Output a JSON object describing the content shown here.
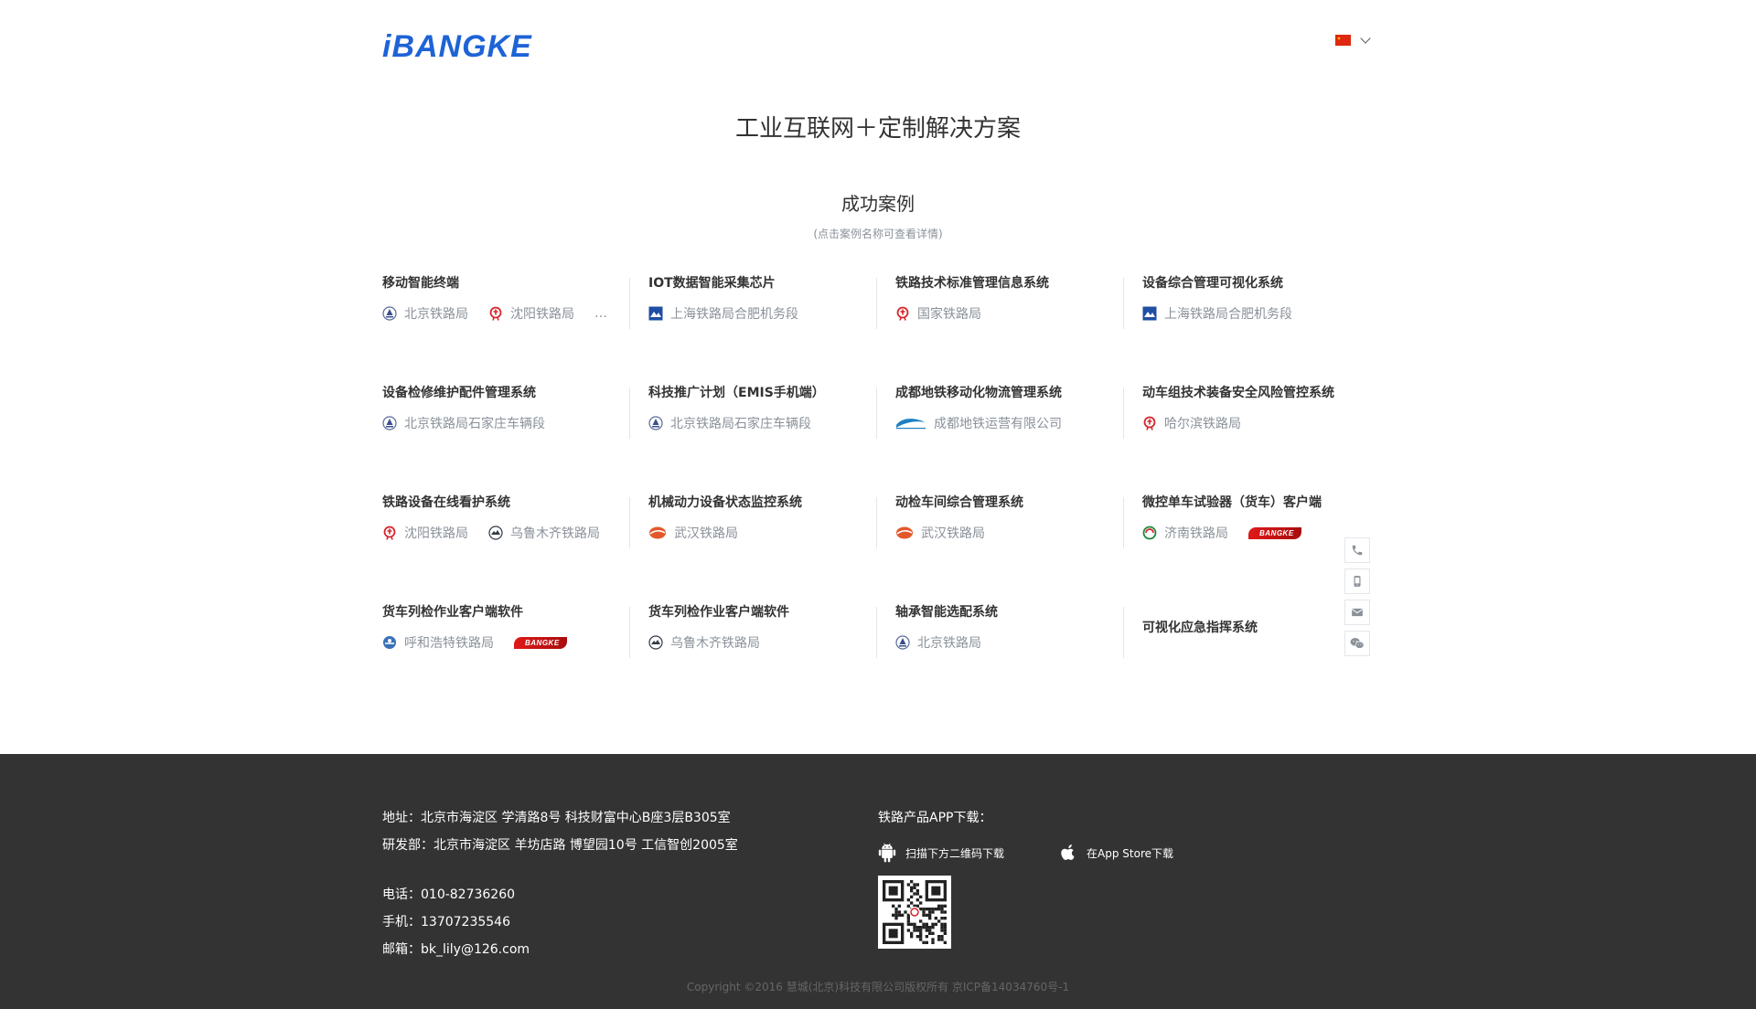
{
  "header": {
    "logo_text": "iBANGKE",
    "language_flag": "china-flag-icon"
  },
  "titles": {
    "main": "工业互联网＋定制解决方案",
    "section": "成功案例",
    "hint": "(点击案例名称可查看详情)"
  },
  "cases": [
    {
      "title": "移动智能终端",
      "clients": [
        {
          "name": "北京铁路局",
          "icon": "beijing-rail-icon"
        },
        {
          "name": "沈阳铁路局",
          "icon": "rail-logo-icon"
        }
      ],
      "more": "…"
    },
    {
      "title": "IOT数据智能采集芯片",
      "clients": [
        {
          "name": "上海铁路局合肥机务段",
          "icon": "shanghai-rail-icon"
        }
      ]
    },
    {
      "title": "铁路技术标准管理信息系统",
      "clients": [
        {
          "name": "国家铁路局",
          "icon": "rail-logo-icon"
        }
      ]
    },
    {
      "title": "设备综合管理可视化系统",
      "clients": [
        {
          "name": "上海铁路局合肥机务段",
          "icon": "shanghai-rail-icon"
        }
      ]
    },
    {
      "title": "设备检修维护配件管理系统",
      "clients": [
        {
          "name": "北京铁路局石家庄车辆段",
          "icon": "beijing-rail-icon"
        }
      ]
    },
    {
      "title": "科技推广计划（EMIS手机端）",
      "clients": [
        {
          "name": "北京铁路局石家庄车辆段",
          "icon": "beijing-rail-icon"
        }
      ]
    },
    {
      "title": "成都地铁移动化物流管理系统",
      "clients": [
        {
          "name": "成都地铁运营有限公司",
          "icon": "chengdu-metro-icon"
        }
      ]
    },
    {
      "title": "动车组技术装备安全风险管控系统",
      "clients": [
        {
          "name": "哈尔滨铁路局",
          "icon": "rail-logo-icon"
        }
      ]
    },
    {
      "title": "铁路设备在线看护系统",
      "clients": [
        {
          "name": "沈阳铁路局",
          "icon": "rail-logo-icon"
        },
        {
          "name": "乌鲁木齐铁路局",
          "icon": "urumqi-rail-icon"
        }
      ]
    },
    {
      "title": "机械动力设备状态监控系统",
      "clients": [
        {
          "name": "武汉铁路局",
          "icon": "wuhan-rail-icon"
        }
      ]
    },
    {
      "title": "动检车间综合管理系统",
      "clients": [
        {
          "name": "武汉铁路局",
          "icon": "wuhan-rail-icon"
        }
      ]
    },
    {
      "title": "微控单车试验器（货车）客户端",
      "clients": [
        {
          "name": "济南铁路局",
          "icon": "jinan-rail-icon"
        },
        {
          "name": "",
          "icon": "bangke-logo-icon",
          "logo_text": "BANGKE"
        }
      ]
    },
    {
      "title": "货车列检作业客户端软件",
      "clients": [
        {
          "name": "呼和浩特铁路局",
          "icon": "hohhot-rail-icon"
        },
        {
          "name": "",
          "icon": "bangke-logo-icon",
          "logo_text": "BANGKE"
        }
      ]
    },
    {
      "title": "货车列检作业客户端软件",
      "clients": [
        {
          "name": "乌鲁木齐铁路局",
          "icon": "urumqi-rail-icon"
        }
      ]
    },
    {
      "title": "轴承智能选配系统",
      "clients": [
        {
          "name": "北京铁路局",
          "icon": "beijing-rail-icon"
        }
      ]
    },
    {
      "title": "可视化应急指挥系统",
      "clients": []
    }
  ],
  "sidebar": [
    "phone-icon",
    "mobile-icon",
    "mail-icon",
    "wechat-icon"
  ],
  "footer": {
    "address": "地址：北京市海淀区 学清路8号 科技财富中心B座3层B305室",
    "rnd": "研发部：北京市海淀区 羊坊店路 博望园10号 工信智创2005室",
    "phone": "电话：010-82736260",
    "mobile": "手机：13707235546",
    "email": "邮箱：bk_lily@126.com",
    "apps_title": "铁路产品APP下载：",
    "android_label": "扫描下方二维码下载",
    "ios_label": "在App Store下载",
    "copyright": "Copyright ©2016 慧城(北京)科技有限公司版权所有    京ICP备14034760号-1"
  },
  "colors": {
    "text": "#333333",
    "muted": "#8a9199",
    "footer_bg": "#333333",
    "footer_muted": "#666666",
    "brand": "#1e63d6"
  }
}
